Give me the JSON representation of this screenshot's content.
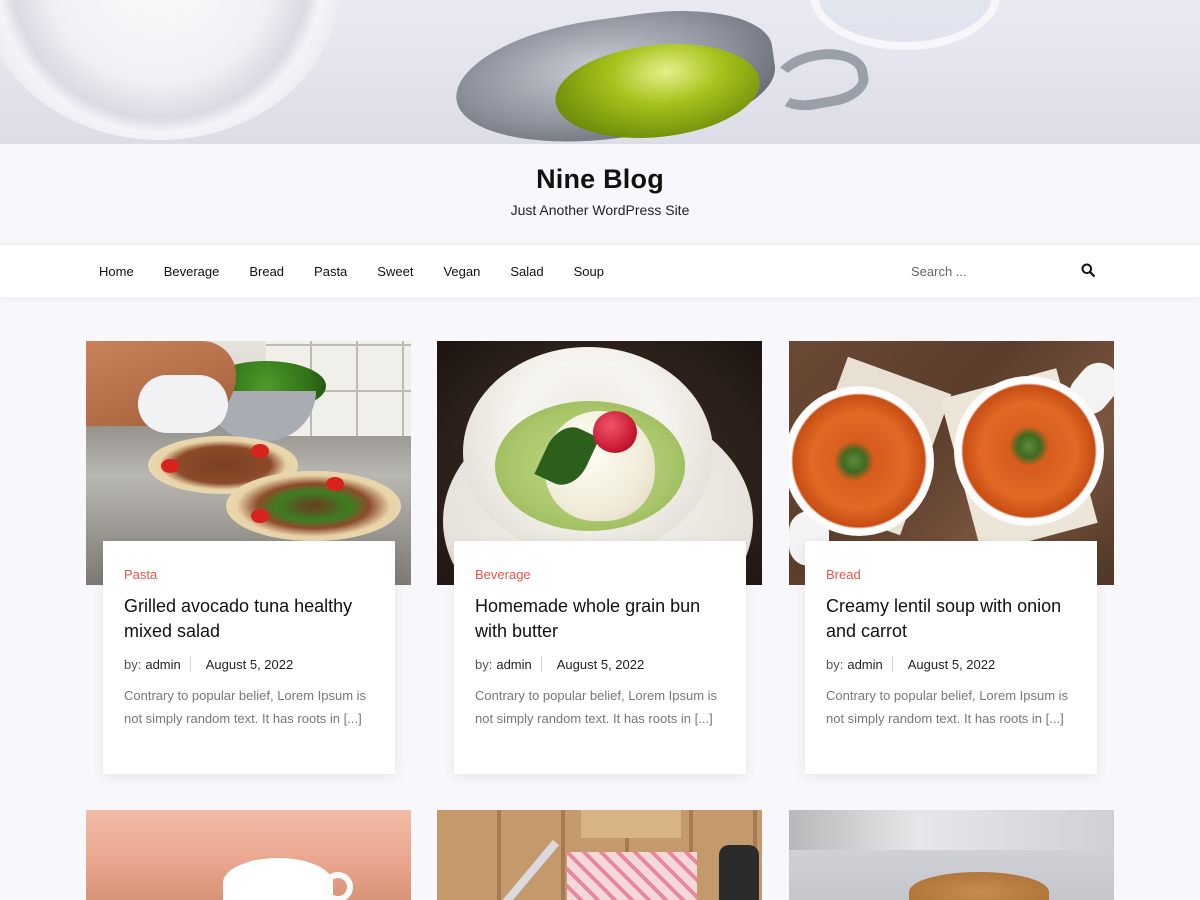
{
  "site": {
    "title": "Nine Blog",
    "tagline": "Just Another WordPress Site"
  },
  "nav": {
    "items": [
      {
        "label": "Home"
      },
      {
        "label": "Beverage"
      },
      {
        "label": "Bread"
      },
      {
        "label": "Pasta"
      },
      {
        "label": "Sweet"
      },
      {
        "label": "Vegan"
      },
      {
        "label": "Salad"
      },
      {
        "label": "Soup"
      }
    ]
  },
  "search": {
    "placeholder": "Search ...",
    "icon": "search-icon"
  },
  "colors": {
    "accent": "#e5574a",
    "background": "#f8f8fc",
    "card": "#ffffff"
  },
  "posts": [
    {
      "category": "Pasta",
      "title": "Grilled avocado tuna healthy mixed salad",
      "by": "by:",
      "author": "admin",
      "date": "August 5, 2022",
      "excerpt": "Contrary to popular belief, Lorem Ipsum is not simply random text. It has roots in [...]"
    },
    {
      "category": "Beverage",
      "title": "Homemade whole grain bun with butter",
      "by": "by:",
      "author": "admin",
      "date": "August 5, 2022",
      "excerpt": "Contrary to popular belief, Lorem Ipsum is not simply random text. It has roots in [...]"
    },
    {
      "category": "Bread",
      "title": "Creamy lentil soup with onion and carrot",
      "by": "by:",
      "author": "admin",
      "date": "August 5, 2022",
      "excerpt": "Contrary to popular belief, Lorem Ipsum is not simply random text. It has roots in [...]"
    }
  ]
}
